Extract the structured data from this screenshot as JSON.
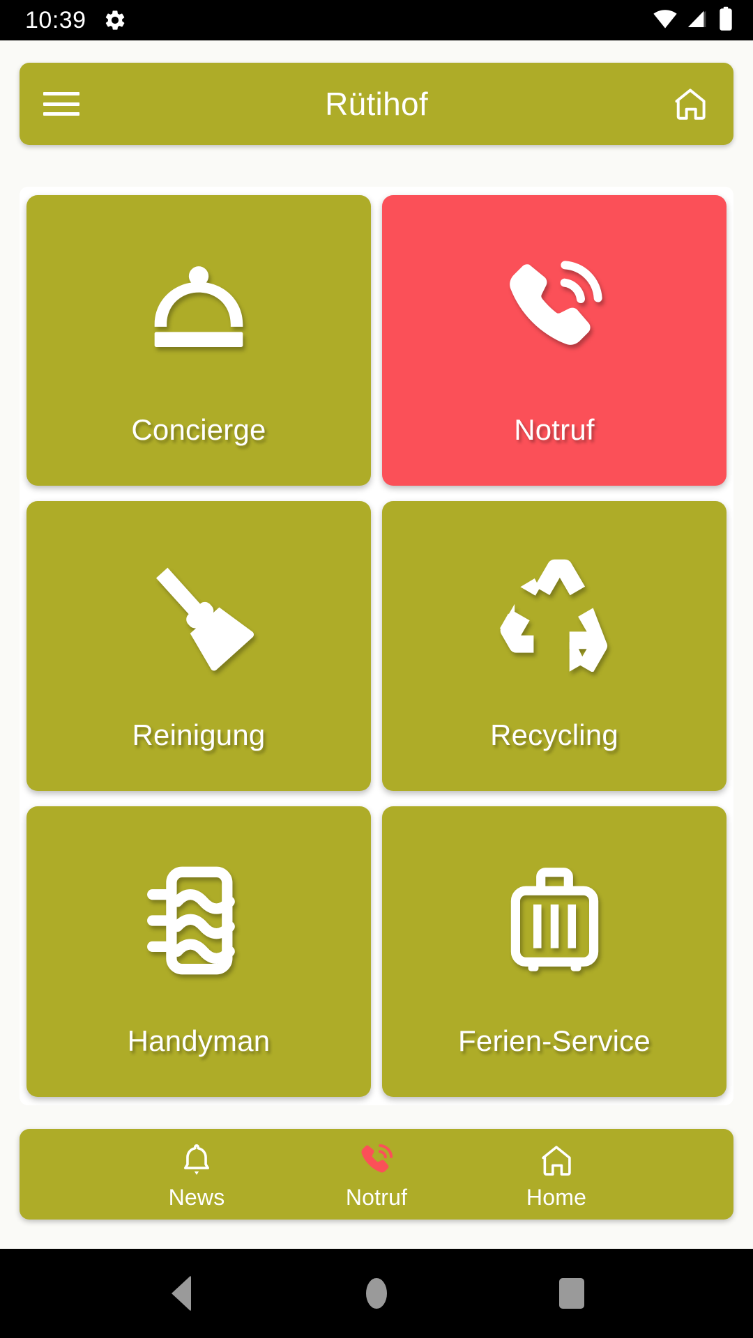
{
  "status_bar": {
    "time": "10:39",
    "icons": [
      "gear-icon",
      "wifi-icon",
      "cellular-signal-icon",
      "battery-icon"
    ]
  },
  "app_bar": {
    "title": "Rütihof",
    "menu_icon": "hamburger-menu-icon",
    "home_icon": "home-icon"
  },
  "colors": {
    "olive": "#AEAC28",
    "red": "#FB5058",
    "white": "#FFFFFF",
    "page_background": "#FAFAF7",
    "card_background": "#FFFFFF",
    "system_nav": "#000000"
  },
  "tiles": [
    {
      "label": "Concierge",
      "icon": "room-service-cloche-icon",
      "color": "#AEAC28"
    },
    {
      "label": "Notruf",
      "icon": "emergency-phone-icon",
      "color": "#FB5058"
    },
    {
      "label": "Reinigung",
      "icon": "broom-icon",
      "color": "#AEAC28"
    },
    {
      "label": "Recycling",
      "icon": "recycling-icon",
      "color": "#AEAC28"
    },
    {
      "label": "Handyman",
      "icon": "radiator-panel-icon",
      "color": "#AEAC28"
    },
    {
      "label": "Ferien-Service",
      "icon": "suitcase-icon",
      "color": "#AEAC28"
    }
  ],
  "bottom_nav": [
    {
      "label": "News",
      "icon": "bell-icon",
      "color": "#FFFFFF"
    },
    {
      "label": "Notruf",
      "icon": "emergency-phone-icon",
      "color": "#FB5058"
    },
    {
      "label": "Home",
      "icon": "home-outline-icon",
      "color": "#FFFFFF"
    }
  ],
  "system_nav": {
    "back": "back-triangle-icon",
    "home": "home-circle-icon",
    "recents": "recents-square-icon"
  }
}
